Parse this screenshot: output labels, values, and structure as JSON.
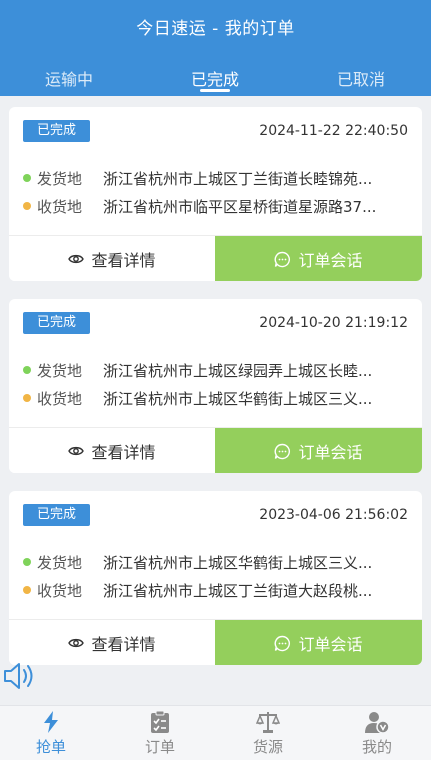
{
  "header": {
    "title": "今日速运 - 我的订单"
  },
  "tabs": [
    {
      "label": "运输中"
    },
    {
      "label": "已完成"
    },
    {
      "label": "已取消"
    }
  ],
  "orders": [
    {
      "status": "已完成",
      "time": "2024-11-22 22:40:50",
      "from_label": "发货地",
      "from": "浙江省杭州市上城区丁兰街道长睦锦苑...",
      "to_label": "收货地",
      "to": "浙江省杭州市临平区星桥街道星源路37...",
      "detail_label": "查看详情",
      "chat_label": "订单会话"
    },
    {
      "status": "已完成",
      "time": "2024-10-20 21:19:12",
      "from_label": "发货地",
      "from": "浙江省杭州市上城区绿园弄上城区长睦...",
      "to_label": "收货地",
      "to": "浙江省杭州市上城区华鹤街上城区三义...",
      "detail_label": "查看详情",
      "chat_label": "订单会话"
    },
    {
      "status": "已完成",
      "time": "2023-04-06 21:56:02",
      "from_label": "发货地",
      "from": "浙江省杭州市上城区华鹤街上城区三义...",
      "to_label": "收货地",
      "to": "浙江省杭州市上城区丁兰街道大赵段桃...",
      "detail_label": "查看详情",
      "chat_label": "订单会话"
    }
  ],
  "nav": [
    {
      "label": "抢单",
      "icon": "lightning-icon"
    },
    {
      "label": "订单",
      "icon": "clipboard-icon"
    },
    {
      "label": "货源",
      "icon": "scale-icon"
    },
    {
      "label": "我的",
      "icon": "user-icon"
    }
  ],
  "colors": {
    "primary": "#3d8fd9",
    "chat_button": "#94cf5c",
    "dot_from": "#7fd35a",
    "dot_to": "#f1b545"
  }
}
